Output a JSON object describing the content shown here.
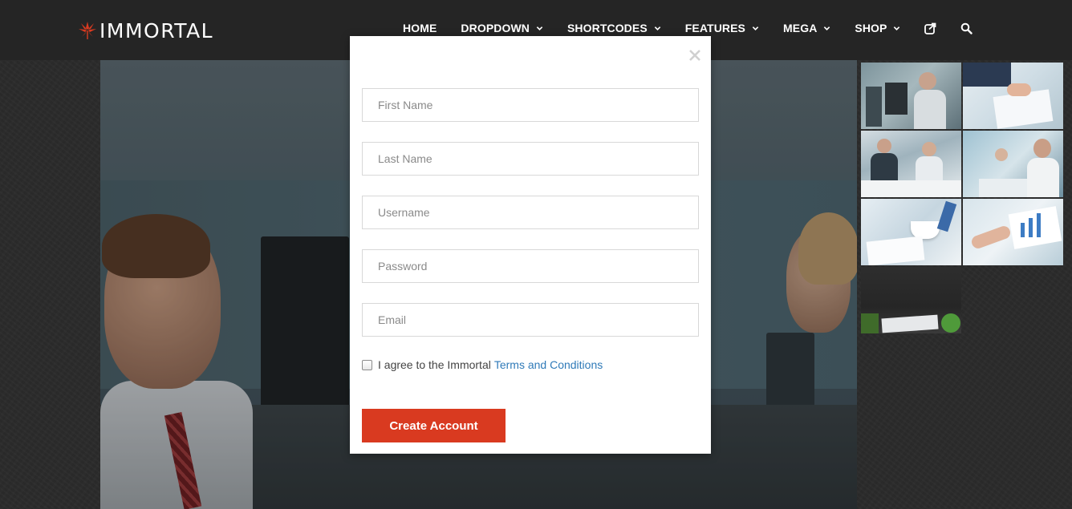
{
  "brand": {
    "name": "IMMORTAL",
    "accent_color": "#d93a20"
  },
  "nav": {
    "items": [
      {
        "label": "HOME",
        "has_dropdown": false
      },
      {
        "label": "DROPDOWN",
        "has_dropdown": true
      },
      {
        "label": "SHORTCODES",
        "has_dropdown": true
      },
      {
        "label": "FEATURES",
        "has_dropdown": true
      },
      {
        "label": "MEGA",
        "has_dropdown": true
      },
      {
        "label": "SHOP",
        "has_dropdown": true
      }
    ],
    "icons": [
      "external-share-icon",
      "search-icon"
    ]
  },
  "modal": {
    "fields": {
      "first_name": {
        "placeholder": "First Name",
        "value": ""
      },
      "last_name": {
        "placeholder": "Last Name",
        "value": ""
      },
      "username": {
        "placeholder": "Username",
        "value": ""
      },
      "password": {
        "placeholder": "Password",
        "value": ""
      },
      "email": {
        "placeholder": "Email",
        "value": ""
      }
    },
    "agree_text": "I agree to the Immortal",
    "terms_link": "Terms and Conditions",
    "agree_checked": false,
    "submit_label": "Create Account",
    "close_icon": "close-icon"
  },
  "thumbnails": [
    {
      "subject": "office workers at computers"
    },
    {
      "subject": "hands signing documents"
    },
    {
      "subject": "business meeting at table"
    },
    {
      "subject": "team smiling at laptop"
    },
    {
      "subject": "coffee cup and papers"
    },
    {
      "subject": "hand pointing at chart"
    },
    {
      "subject": "keyboard and plant on dark desk"
    }
  ]
}
